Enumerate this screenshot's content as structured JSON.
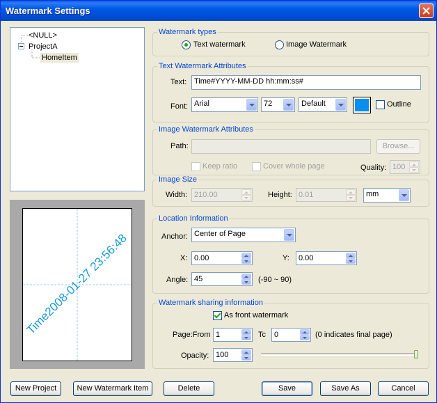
{
  "window": {
    "title": "Watermark Settings"
  },
  "tree": {
    "items": [
      "<NULL>",
      "ProjectA",
      "HomeItem"
    ]
  },
  "preview": {
    "text": "Time2008-01-27 23:56:48",
    "angle_deg": 45
  },
  "types": {
    "title": "Watermark types",
    "text_option": "Text watermark",
    "image_option": "Image Watermark",
    "selected": "text"
  },
  "text_attrs": {
    "title": "Text Watermark Attributes",
    "text_label": "Text:",
    "text_value": "Time#YYYY-MM-DD hh:mm:ss#",
    "font_label": "Font:",
    "font_value": "Arial",
    "size_value": "72",
    "style_value": "Default",
    "color": "#0A8EF0",
    "outline_label": "Outline",
    "outline_checked": false
  },
  "image_attrs": {
    "title": "Image Watermark Attributes",
    "path_label": "Path:",
    "path_value": "",
    "browse_label": "Browse...",
    "keep_ratio_label": "Keep ratio",
    "cover_label": "Cover whole page",
    "quality_label": "Quality:",
    "quality_value": "100"
  },
  "image_size": {
    "title": "Image Size",
    "width_label": "Width:",
    "width_value": "210.00",
    "height_label": "Height:",
    "height_value": "0.01",
    "unit_value": "mm"
  },
  "location": {
    "title": "Location Information",
    "anchor_label": "Anchor:",
    "anchor_value": "Center of Page",
    "x_label": "X:",
    "x_value": "0.00",
    "y_label": "Y:",
    "y_value": "0.00",
    "angle_label": "Angle:",
    "angle_value": "45",
    "angle_range": "(-90 ~ 90)"
  },
  "sharing": {
    "title": "Watermark sharing information",
    "front_label": "As front watermark",
    "front_checked": true,
    "page_from_label": "Page:From",
    "page_from_value": "1",
    "to_label": "Tc",
    "to_value": "0",
    "to_note": "(0 indicates final page)",
    "opacity_label": "Opacity:",
    "opacity_value": "100",
    "opacity_slider_fraction": 1.0
  },
  "buttons": {
    "new_project": "New Project",
    "new_item": "New Watermark Item",
    "delete": "Delete",
    "save": "Save",
    "save_as": "Save As",
    "cancel": "Cancel"
  }
}
